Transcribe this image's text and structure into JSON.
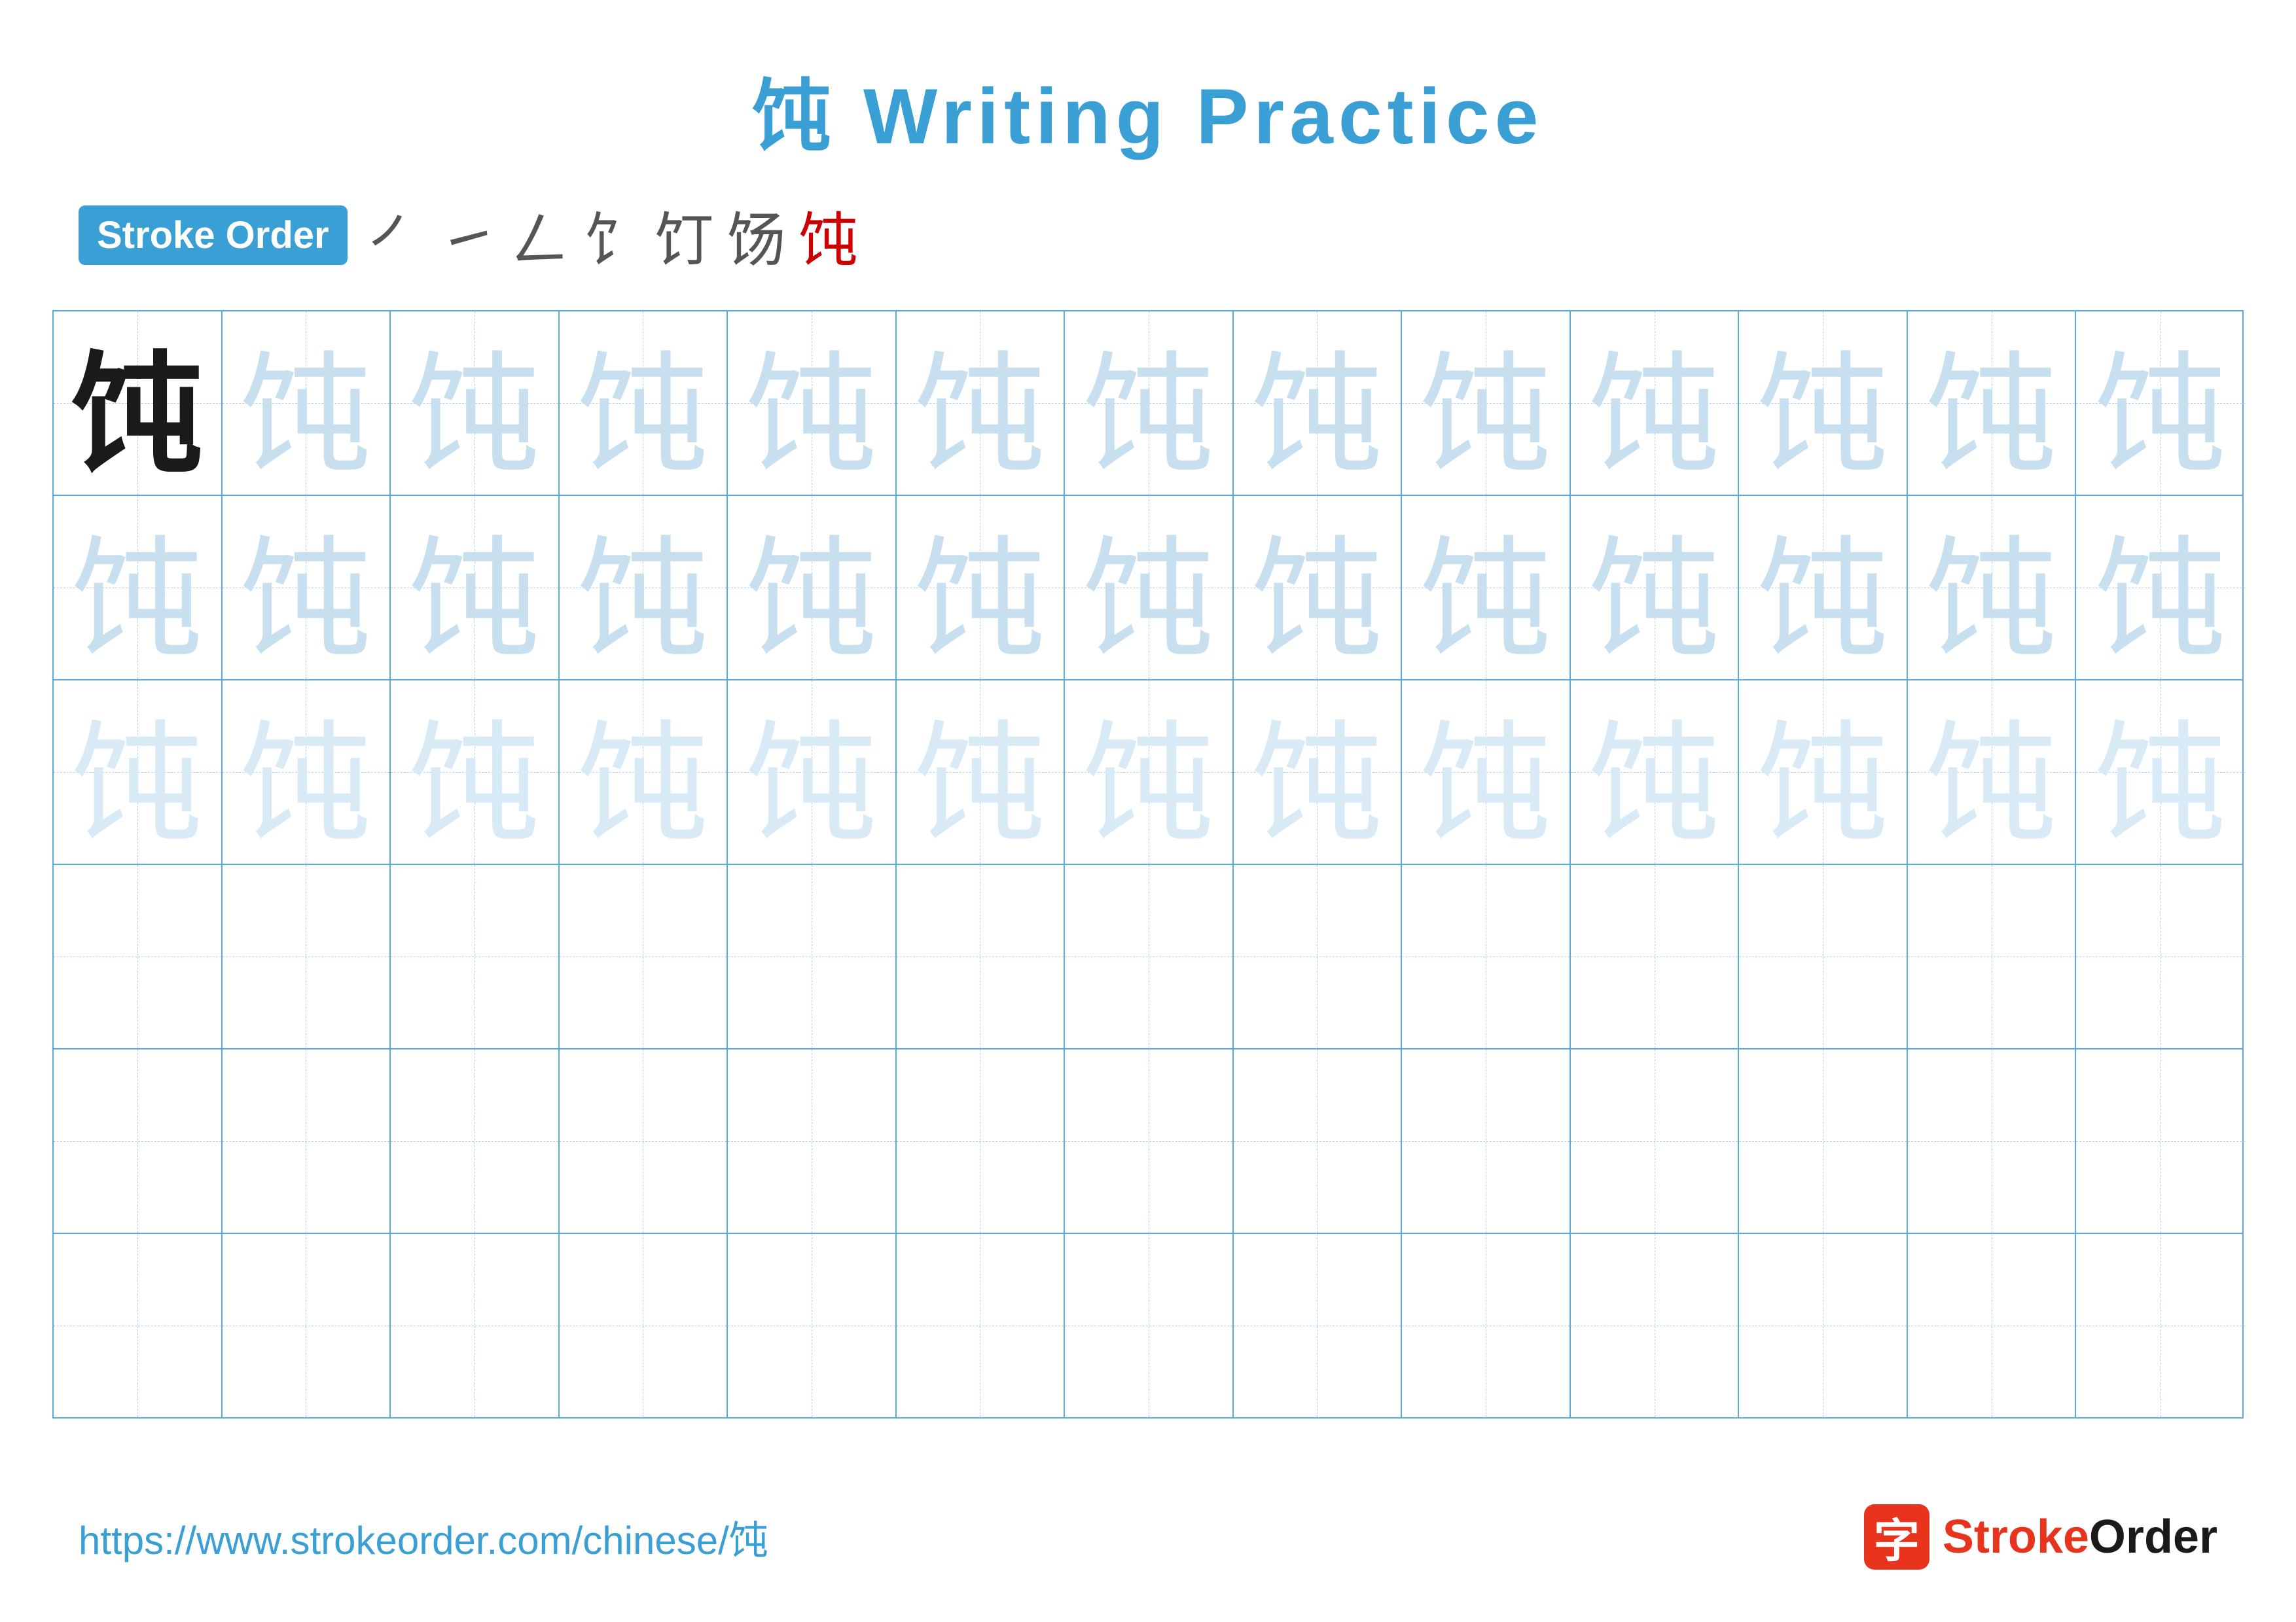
{
  "page": {
    "title": "饨 Writing Practice",
    "title_char": "饨",
    "title_suffix": " Writing Practice",
    "stroke_order_label": "Stroke Order",
    "stroke_sequence": [
      "㇐",
      "㇀",
      "𠃋",
      "饣",
      "饤",
      "饧",
      "饨"
    ],
    "character": "饨",
    "footer_url": "https://www.strokeorder.com/chinese/饨",
    "footer_logo_char": "字",
    "footer_logo_name": "StrokeOrder",
    "footer_logo_stroke": "Stroke",
    "footer_logo_order": "Order",
    "grid": {
      "rows": 6,
      "cols": 13,
      "row_configs": [
        {
          "type": "dark_then_light",
          "dark_count": 1
        },
        {
          "type": "all_light"
        },
        {
          "type": "all_lighter"
        },
        {
          "type": "empty"
        },
        {
          "type": "empty"
        },
        {
          "type": "empty"
        }
      ]
    }
  }
}
